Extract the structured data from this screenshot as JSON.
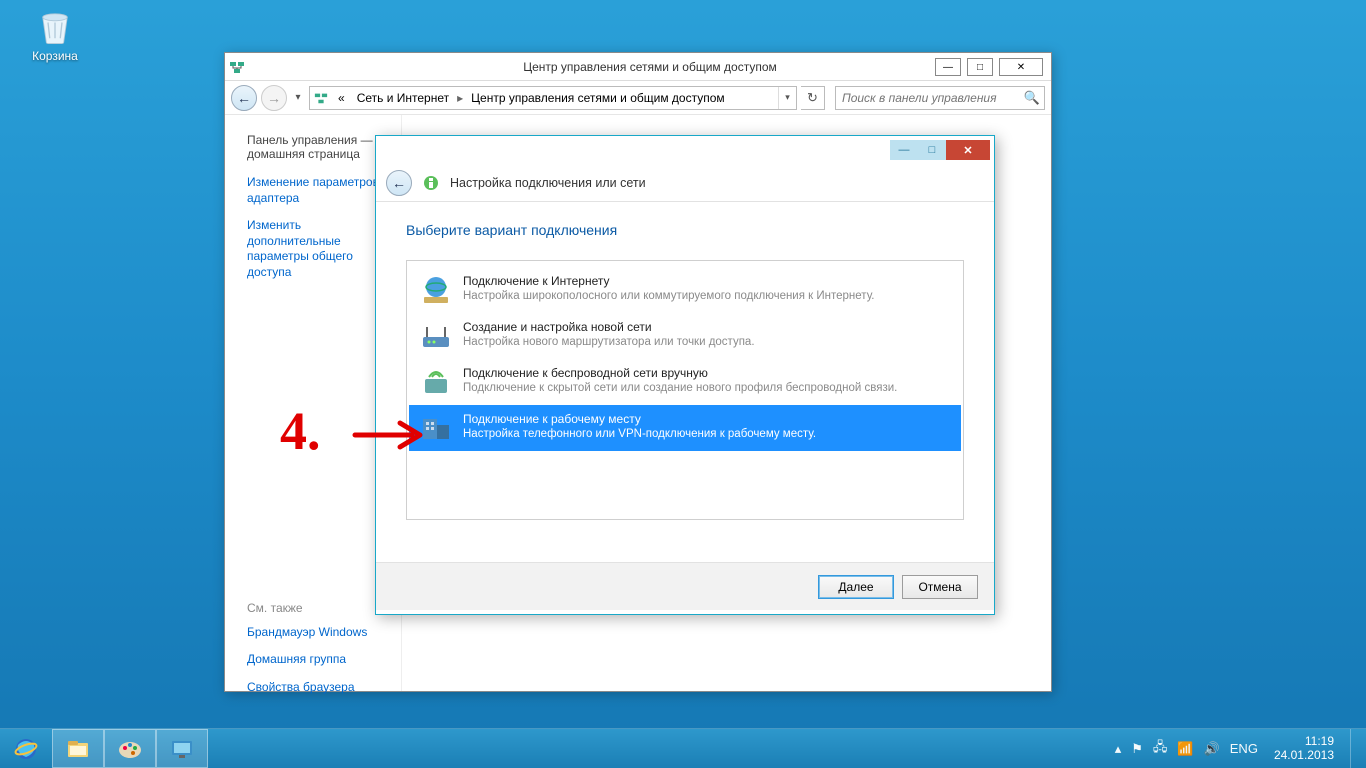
{
  "desktop": {
    "recycle_bin": "Корзина"
  },
  "control_panel": {
    "title": "Центр управления сетями и общим доступом",
    "breadcrumb": {
      "prefix": "«",
      "seg1": "Сеть и Интернет",
      "seg2": "Центр управления сетями и общим доступом"
    },
    "search_placeholder": "Поиск в панели управления",
    "side": {
      "home": "Панель управления — домашняя страница",
      "link1": "Изменение параметров адаптера",
      "link2": "Изменить дополнительные параметры общего доступа",
      "see_also": "См. также",
      "sa1": "Брандмауэр Windows",
      "sa2": "Домашняя группа",
      "sa3": "Свойства браузера"
    }
  },
  "wizard": {
    "header_title": "Настройка подключения или сети",
    "heading": "Выберите вариант подключения",
    "options": [
      {
        "title": "Подключение к Интернету",
        "desc": "Настройка широкополосного или коммутируемого подключения к Интернету.",
        "selected": false
      },
      {
        "title": "Создание и настройка новой сети",
        "desc": "Настройка нового маршрутизатора или точки доступа.",
        "selected": false
      },
      {
        "title": "Подключение к беспроводной сети вручную",
        "desc": "Подключение к скрытой сети или создание нового профиля беспроводной связи.",
        "selected": false
      },
      {
        "title": "Подключение к рабочему месту",
        "desc": "Настройка телефонного или VPN-подключения к рабочему месту.",
        "selected": true
      }
    ],
    "buttons": {
      "next": "Далее",
      "cancel": "Отмена"
    }
  },
  "annotation": {
    "number": "4."
  },
  "taskbar": {
    "lang": "ENG",
    "time": "11:19",
    "date": "24.01.2013"
  }
}
